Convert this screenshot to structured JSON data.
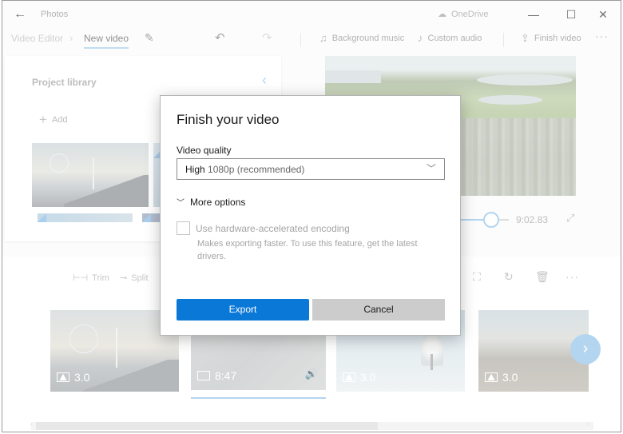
{
  "titlebar": {
    "back_icon": "arrow-left-icon",
    "app_title": "Photos",
    "onedrive_label": "OneDrive",
    "onedrive_icon": "cloud-off-icon",
    "minimize_glyph": "—",
    "maximize_glyph": "☐",
    "close_glyph": "✕"
  },
  "toolbar": {
    "breadcrumb_root": "Video Editor",
    "breadcrumb_separator": "›",
    "breadcrumb_current": "New video",
    "edit_icon": "pencil-icon",
    "undo_icon": "undo-icon",
    "redo_icon": "redo-icon",
    "background_music": "Background music",
    "custom_audio": "Custom audio",
    "finish_video": "Finish video",
    "more": "···"
  },
  "library": {
    "title": "Project library",
    "add_label": "Add",
    "collapse_glyph": "‹"
  },
  "preview": {
    "time": "9:02.83",
    "progress": 0.87,
    "fullscreen_icon": "expand-icon"
  },
  "storyboard": {
    "tools": [
      {
        "label": "Trim",
        "icon": "trim-icon"
      },
      {
        "label": "Split",
        "icon": "split-icon"
      }
    ],
    "right_icons": [
      "crop-icon",
      "rotate-icon",
      "delete-icon",
      "more-icon"
    ],
    "clips": [
      {
        "type": "image",
        "duration": "3.0"
      },
      {
        "type": "video",
        "duration": "8:47",
        "audio": true,
        "selected": true
      },
      {
        "type": "image",
        "duration": "3.0"
      },
      {
        "type": "image",
        "duration": "3.0"
      }
    ],
    "next_glyph": "›"
  },
  "dialog": {
    "title": "Finish your video",
    "quality_label": "Video quality",
    "quality_value_main": "High",
    "quality_value_sub": "1080p (recommended)",
    "more_options": "More options",
    "hw_encoding_label": "Use hardware-accelerated encoding",
    "hw_encoding_checked": false,
    "hw_encoding_desc": "Makes exporting faster. To use this feature, get the latest drivers.",
    "export_label": "Export",
    "cancel_label": "Cancel",
    "accent_color": "#0a78d7"
  }
}
